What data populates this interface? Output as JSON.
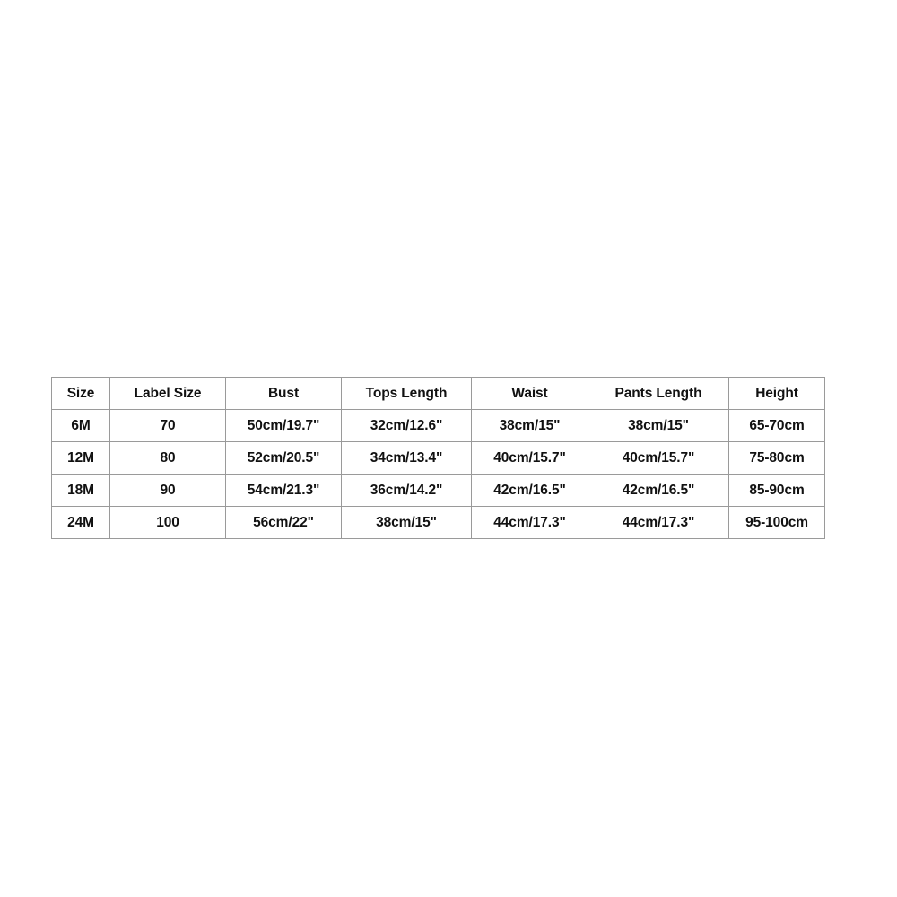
{
  "document": {
    "type": "size-chart-table",
    "background_color": "#ffffff",
    "border_color": "#9a9a9a",
    "text_color": "#111111"
  },
  "table": {
    "columns": [
      "Size",
      "Label Size",
      "Bust",
      "Tops Length",
      "Waist",
      "Pants Length",
      "Height"
    ],
    "rows": [
      {
        "size": "6M",
        "label_size": "70",
        "bust": "50cm/19.7\"",
        "tops_length": "32cm/12.6\"",
        "waist": "38cm/15\"",
        "pants_length": "38cm/15\"",
        "height": "65-70cm"
      },
      {
        "size": "12M",
        "label_size": "80",
        "bust": "52cm/20.5\"",
        "tops_length": "34cm/13.4\"",
        "waist": "40cm/15.7\"",
        "pants_length": "40cm/15.7\"",
        "height": "75-80cm"
      },
      {
        "size": "18M",
        "label_size": "90",
        "bust": "54cm/21.3\"",
        "tops_length": "36cm/14.2\"",
        "waist": "42cm/16.5\"",
        "pants_length": "42cm/16.5\"",
        "height": "85-90cm"
      },
      {
        "size": "24M",
        "label_size": "100",
        "bust": "56cm/22\"",
        "tops_length": "38cm/15\"",
        "waist": "44cm/17.3\"",
        "pants_length": "44cm/17.3\"",
        "height": "95-100cm"
      }
    ]
  }
}
